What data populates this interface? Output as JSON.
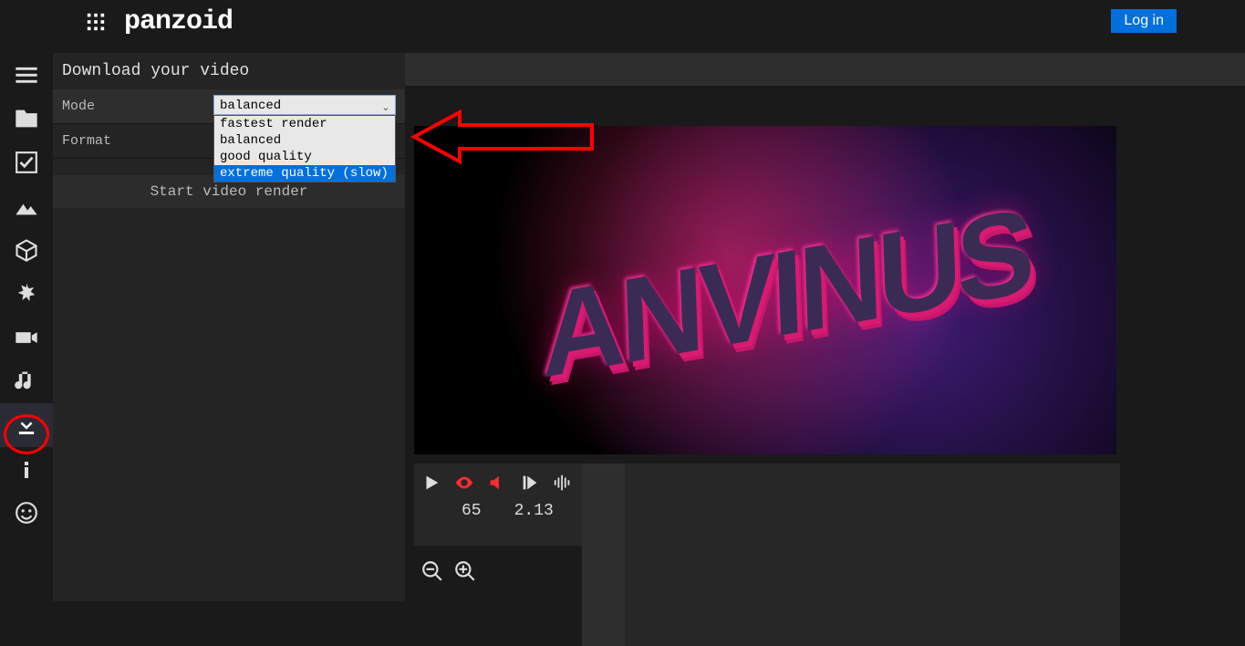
{
  "header": {
    "logo_text": "panzoid",
    "login_label": "Log in"
  },
  "panel": {
    "title": "Download your video",
    "mode_label": "Mode",
    "format_label": "Format",
    "mode_selected": "balanced",
    "mode_options": {
      "o0": "fastest render",
      "o1": "balanced",
      "o2": "good quality",
      "o3": "extreme quality (slow)"
    },
    "render_button": "Start video render"
  },
  "preview": {
    "text": "ANVINUS"
  },
  "playback": {
    "frame": "65",
    "time": "2.13"
  },
  "colors": {
    "accent_blue": "#0070dd",
    "annotation_red": "#ff0000"
  }
}
